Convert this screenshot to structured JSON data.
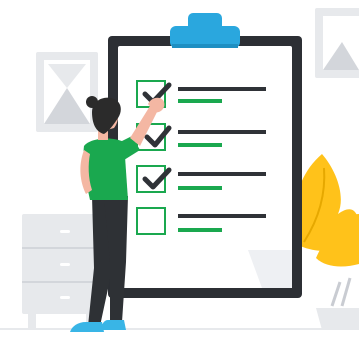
{
  "illustration": {
    "subject": "checklist-clipboard",
    "colors": {
      "background": "#ffffff",
      "faded_gray": "#e7e9ec",
      "faded_gray_dark": "#d3d6db",
      "clipboard_border": "#2c2f34",
      "clipboard_paper": "#ffffff",
      "clip": "#2aa7de",
      "accent_green": "#1aa84f",
      "line_dark": "#2f3237",
      "skin": "#f4b7a3",
      "hair": "#2b2b2b",
      "shirt": "#1aa84f",
      "pants": "#2e3135",
      "shoe": "#39b5e6",
      "leaf": "#ffc21a"
    },
    "checklist": {
      "items": [
        {
          "checked": true
        },
        {
          "checked": true
        },
        {
          "checked": true
        },
        {
          "checked": false
        }
      ]
    }
  }
}
